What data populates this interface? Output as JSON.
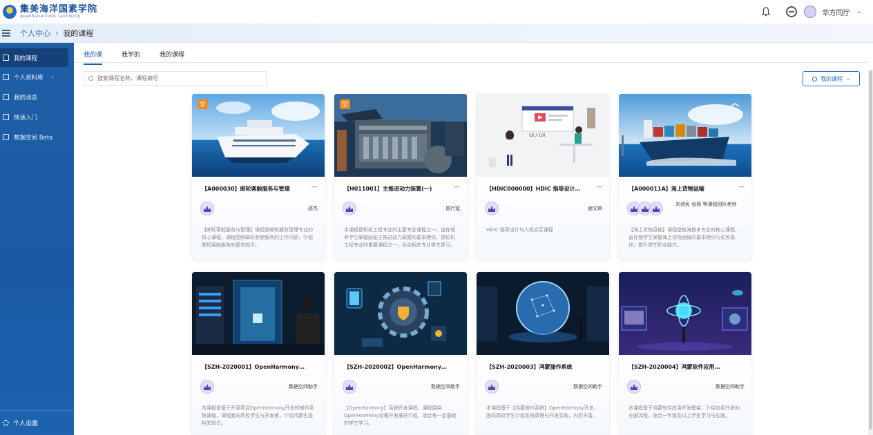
{
  "header": {
    "logo_cn": "集美海洋国素学院",
    "logo_en": "qeakhanacluon ranhiking",
    "user_name": "华方同厅"
  },
  "breadcrumb": {
    "parent": "个人中心",
    "separator": "›",
    "current": "我的课程"
  },
  "sidebar": {
    "items": [
      {
        "label": "我的课程"
      },
      {
        "label": "个人资料库"
      },
      {
        "label": "我的消息"
      },
      {
        "label": "快速入门"
      },
      {
        "label": "数据空间 Beta"
      }
    ],
    "footer": "个人设置"
  },
  "tabs": [
    "我的课",
    "我学的",
    "我的课程"
  ],
  "search": {
    "placeholder": "搜索课程名称、课程编号"
  },
  "filter_button": {
    "label": "我的课程"
  },
  "cards": [
    {
      "tag": "学",
      "title": "【A000030】邮轮客舱服务与管理",
      "meta": "邵杰",
      "desc": "【邮轮客舱服务与管理】课程是邮轮服务管理专业的核心课程，课程围绕邮轮客舱服务的工作内容，介绍邮轮客舱服务的基本知识。"
    },
    {
      "tag": "学",
      "title": "【H011001】主推进动力装置(一)",
      "meta": "曾行宽",
      "desc": "本课程是轮机工程专业的主要专业课程之一，旨在培养学生掌握船舶主推进动力装置的基本理论，是轮机工程专业的重要课程之一，适合相关专业学生学习。"
    },
    {
      "tag": "",
      "title": "【HDIC000000】HDIC 指导设计…",
      "meta": "谢文柳",
      "desc": "HDIC 指导设计与人机交互课程"
    },
    {
      "tag": "",
      "title": "【A000011A】海上货物运输",
      "meta": "刘诗民 张薇 等课程团队老师",
      "desc": "【海上货物运输】课程是航海技术专业的核心课程，旨在使学生掌握海上货物运输的基本理论与实务操作，提升学生职业能力。"
    },
    {
      "tag": "",
      "title": "【SZH-2020001】OpenHarmony…",
      "meta": "数据空间助手",
      "desc": "本课程是基于开源项目OpenHarmony开发的操作系统课程，课程面向高校学生与开发者，介绍鸿蒙生态相关知识。"
    },
    {
      "tag": "",
      "title": "【SZH-2020002】OpenHarmony…",
      "meta": "数据空间助手",
      "desc": "【OpenHarmony】系统开发课程，课程围绕OpenHarmony设备开发展开介绍，适合有一定基础的学生学习。"
    },
    {
      "tag": "",
      "title": "【SZH-2020003】鸿蒙操作系统",
      "meta": "数据空间助手",
      "desc": "本课程基于【鸿蒙操作系统】OpenHarmony开发，面向高校学生介绍系统原理与开发实践，内容丰富。"
    },
    {
      "tag": "",
      "title": "【SZH-2020004】鸿蒙软件应用…",
      "meta": "数据空间助手",
      "desc": "本课程基于鸿蒙软件应用开发框架，介绍应用开发的全部流程，适合一年级及以上学生学习与实践。"
    }
  ],
  "colors": {
    "sidebar": "#1f5fa8",
    "accent": "#1f5fa8",
    "tag": "#f08a24"
  }
}
